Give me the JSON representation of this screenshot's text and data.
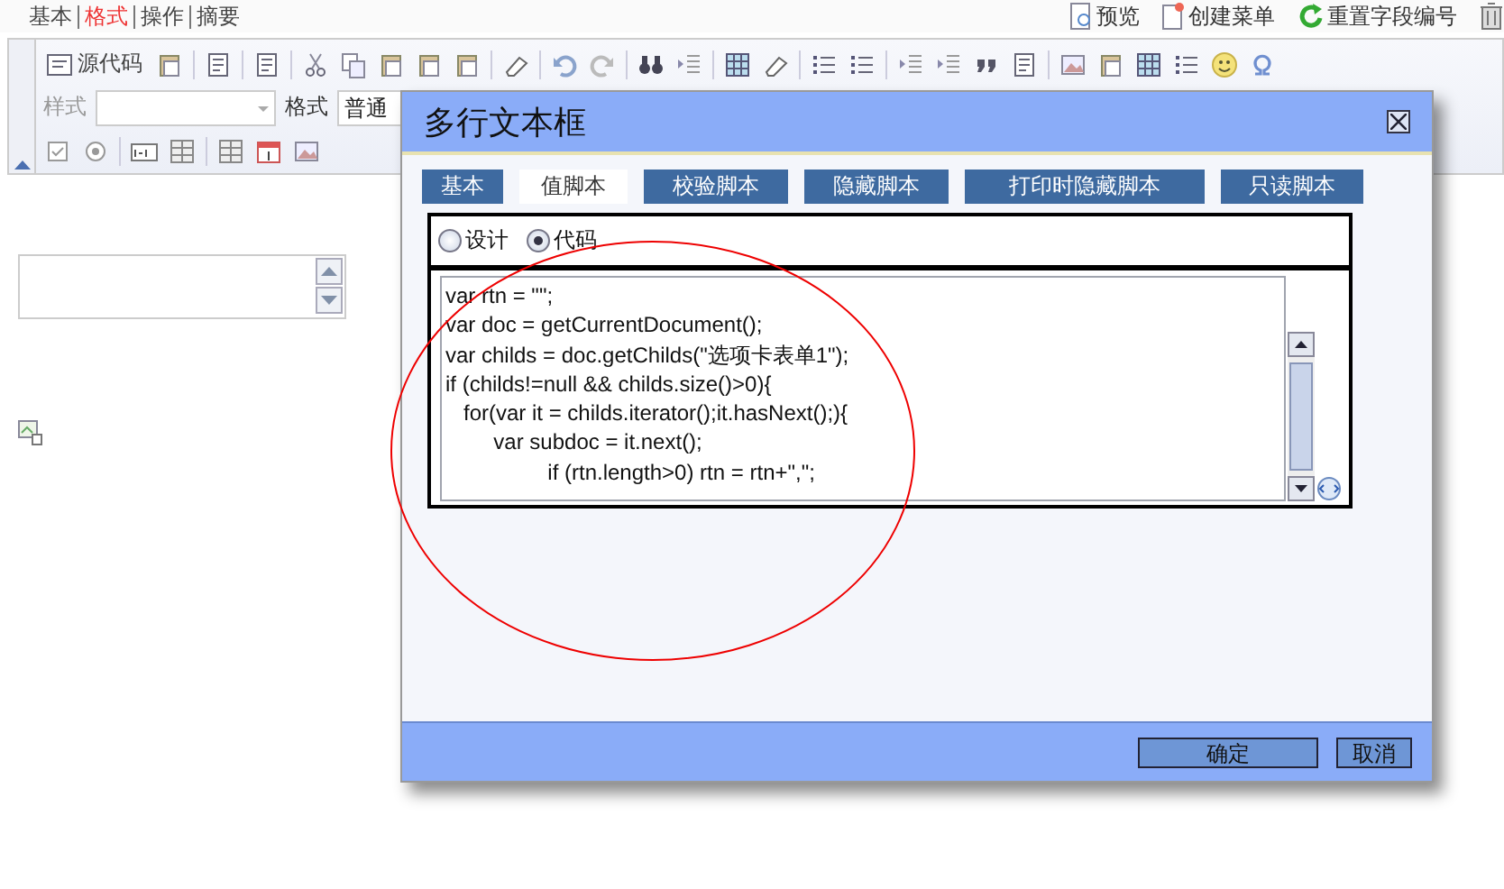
{
  "top_tabs": [
    {
      "label": "基本",
      "selected": false
    },
    {
      "label": "格式",
      "selected": true
    },
    {
      "label": "操作",
      "selected": false
    },
    {
      "label": "摘要",
      "selected": false
    }
  ],
  "top_actions": [
    {
      "label": "预览",
      "kind": "preview"
    },
    {
      "label": "创建菜单",
      "kind": "menu"
    },
    {
      "label": "重置字段编号",
      "kind": "reset"
    }
  ],
  "toolbar": {
    "source_button": "源代码",
    "style_label": "样式",
    "format_label": "格式",
    "format_value": "普通"
  },
  "dialog": {
    "title": "多行文本框",
    "tabs": [
      {
        "label": "基本",
        "selected": false
      },
      {
        "label": "值脚本",
        "selected": true
      },
      {
        "label": "校验脚本",
        "selected": false
      },
      {
        "label": "隐藏脚本",
        "selected": false
      },
      {
        "label": "打印时隐藏脚本",
        "selected": false
      },
      {
        "label": "只读脚本",
        "selected": false
      }
    ],
    "modes": [
      {
        "label": "设计",
        "selected": false
      },
      {
        "label": "代码",
        "selected": true
      }
    ],
    "code_lines": [
      "var rtn = \"\";",
      "var doc = getCurrentDocument();",
      "var childs = doc.getChilds(\"选项卡表单1\");",
      "if (childs!=null && childs.size()>0){",
      "   for(var it = childs.iterator();it.hasNext();){",
      "        var subdoc = it.next();",
      "                 if (rtn.length>0) rtn = rtn+\",\";"
    ],
    "buttons": [
      "确定",
      "取消"
    ]
  }
}
